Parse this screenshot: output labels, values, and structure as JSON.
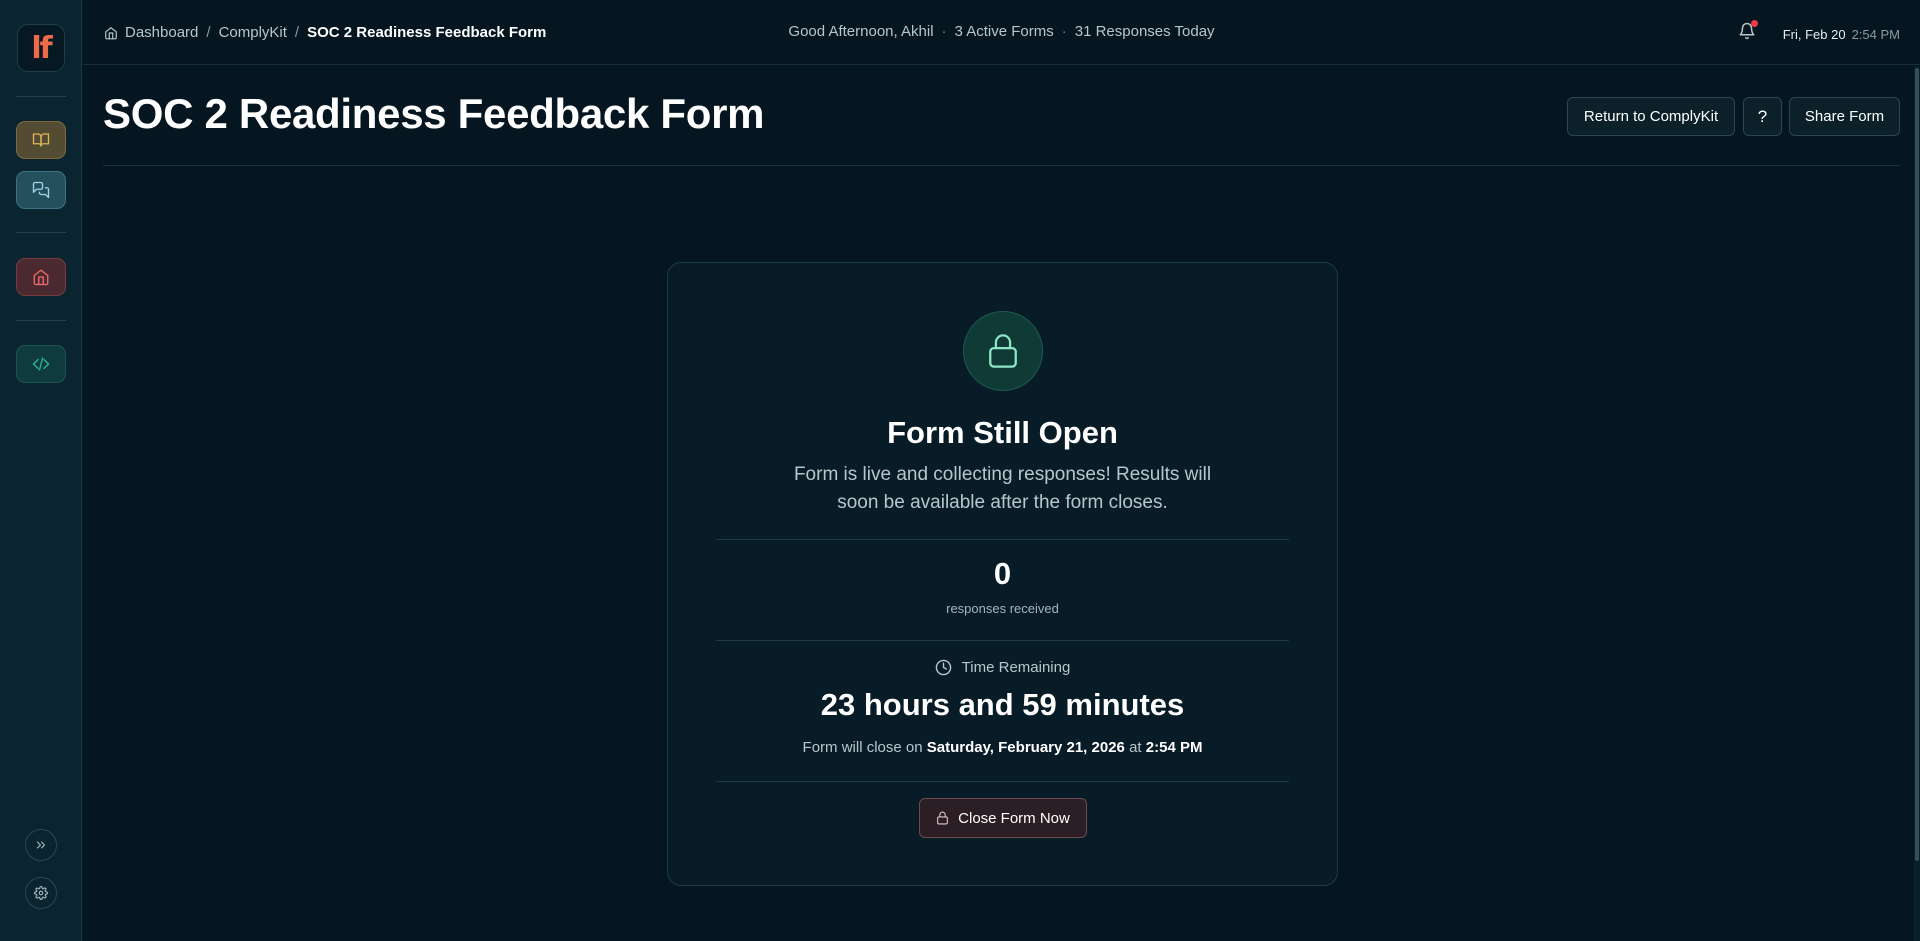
{
  "app": {
    "logo_text": "lf",
    "accent_color": "#ef6a4a"
  },
  "sidebar": {
    "items": [
      {
        "icon": "book-icon",
        "color": "#e0b45a"
      },
      {
        "icon": "chat-icon",
        "color": "#9fd4e4"
      },
      {
        "icon": "home-icon",
        "color": "#ef6a6a"
      },
      {
        "icon": "code-icon",
        "color": "#2fb39a"
      }
    ],
    "bottom": [
      {
        "icon": "chevrons-right-icon"
      },
      {
        "icon": "gear-icon"
      }
    ]
  },
  "topbar": {
    "breadcrumb": [
      "Dashboard",
      "ComplyKit",
      "SOC 2 Readiness Feedback Form"
    ],
    "greeting": "Good Afternoon, Akhil",
    "active_forms": "3 Active Forms",
    "responses_today": "31 Responses Today",
    "date": "Fri, Feb 20",
    "time": "2:54 PM",
    "notification_badge_color": "#ef3a4a"
  },
  "page": {
    "title": "SOC 2 Readiness Feedback Form",
    "buttons": {
      "return": "Return to ComplyKit",
      "help": "?",
      "share": "Share Form"
    }
  },
  "card": {
    "title": "Form Still Open",
    "description": "Form is live and collecting responses! Results will soon be available after the form closes.",
    "response_count": "0",
    "response_label": "responses received",
    "time_heading": "Time Remaining",
    "time_remaining": "23 hours and 59 minutes",
    "close_prefix": "Form will close on",
    "close_date": "Saturday, February 21, 2026",
    "close_at": "at",
    "close_time": "2:54 PM",
    "close_button": "Close Form Now",
    "status_color": "#3fcfa5"
  }
}
